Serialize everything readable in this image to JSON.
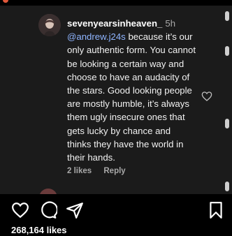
{
  "comment": {
    "username": "sevenyearsinheaven_",
    "time": "5h",
    "mention": "@andrew.j24s",
    "text": " because it’s our only authentic form. You cannot be looking a certain way and choose to have an audacity of the stars. Good looking people are mostly humble, it’s always them ugly insecure ones that gets lucky by chance and thinks they have the world in their hands.",
    "likes": "2 likes",
    "reply": "Reply"
  },
  "post": {
    "likes": "268,164 likes"
  },
  "icons": {
    "comment_like": "heart-outline-icon",
    "like": "heart-icon",
    "comment": "comment-bubble-icon",
    "share": "send-paper-plane-icon",
    "save": "bookmark-icon"
  },
  "colors": {
    "background": "#000000",
    "panel": "#1b1b1b",
    "mention": "#8fb5ff",
    "muted": "#a8a8a8"
  }
}
